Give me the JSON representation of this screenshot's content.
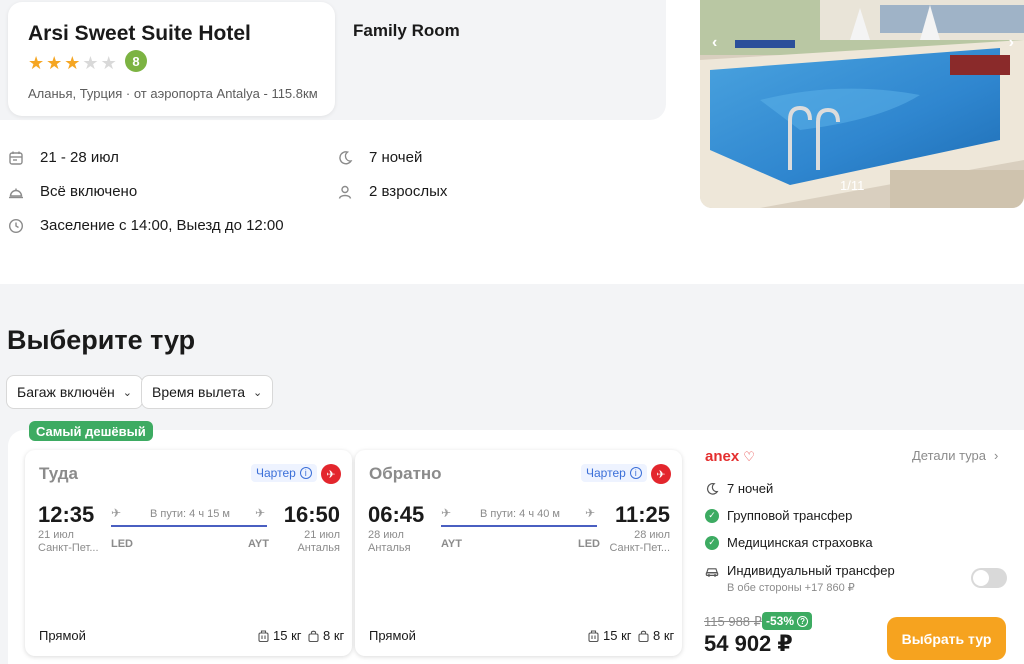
{
  "hotel": {
    "name": "Arsi Sweet Suite Hotel",
    "stars_filled": 3,
    "stars_total": 5,
    "rating": "8",
    "location": "Аланья, Турция",
    "airport": "от аэропорта Antalya - 115.8км",
    "room": "Family Room"
  },
  "details": {
    "dates": "21 - 28 июл",
    "nights": "7 ночей",
    "meal": "Всё включено",
    "guests": "2 взрослых",
    "checkin": "Заселение с 14:00, Выезд до 12:00"
  },
  "gallery": {
    "counter": "1/11",
    "prev": "‹",
    "next": "›"
  },
  "tours": {
    "title": "Выберите тур",
    "filters": [
      {
        "label": "Багаж включён"
      },
      {
        "label": "Время вылета"
      }
    ],
    "badge": "Самый дешёвый",
    "outbound": {
      "title": "Туда",
      "charter": "Чартер",
      "dep_time": "12:35",
      "dep_date": "21 июл",
      "dep_city": "Санкт-Пет...",
      "dep_code": "LED",
      "duration": "В пути: 4 ч 15 м",
      "arr_time": "16:50",
      "arr_date": "21 июл",
      "arr_city": "Анталья",
      "arr_code": "AYT",
      "type": "Прямой",
      "baggage": "15 кг",
      "hand": "8 кг"
    },
    "inbound": {
      "title": "Обратно",
      "charter": "Чартер",
      "dep_time": "06:45",
      "dep_date": "28 июл",
      "dep_city": "Анталья",
      "dep_code": "AYT",
      "duration": "В пути: 4 ч 40 м",
      "arr_time": "11:25",
      "arr_date": "28 июл",
      "arr_city": "Санкт-Пет...",
      "arr_code": "LED",
      "type": "Прямой",
      "baggage": "15 кг",
      "hand": "8 кг"
    },
    "operator": {
      "name": "anex",
      "details_link": "Детали тура",
      "nights": "7 ночей",
      "transfer": "Групповой трансфер",
      "insurance": "Медицинская страховка",
      "individual_transfer": "Индивидуальный трансфер",
      "individual_transfer_note": "В обе стороны +17 860 ₽"
    },
    "pricing": {
      "old_price": "115 988 ₽",
      "discount": "-53%",
      "price": "54 902 ₽",
      "button": "Выбрать тур"
    }
  },
  "colors": {
    "accent": "#f6a31f",
    "green": "#3dab62",
    "star": "#f5a623",
    "link_blue": "#3b6fd8",
    "airline_red": "#e3262d"
  }
}
